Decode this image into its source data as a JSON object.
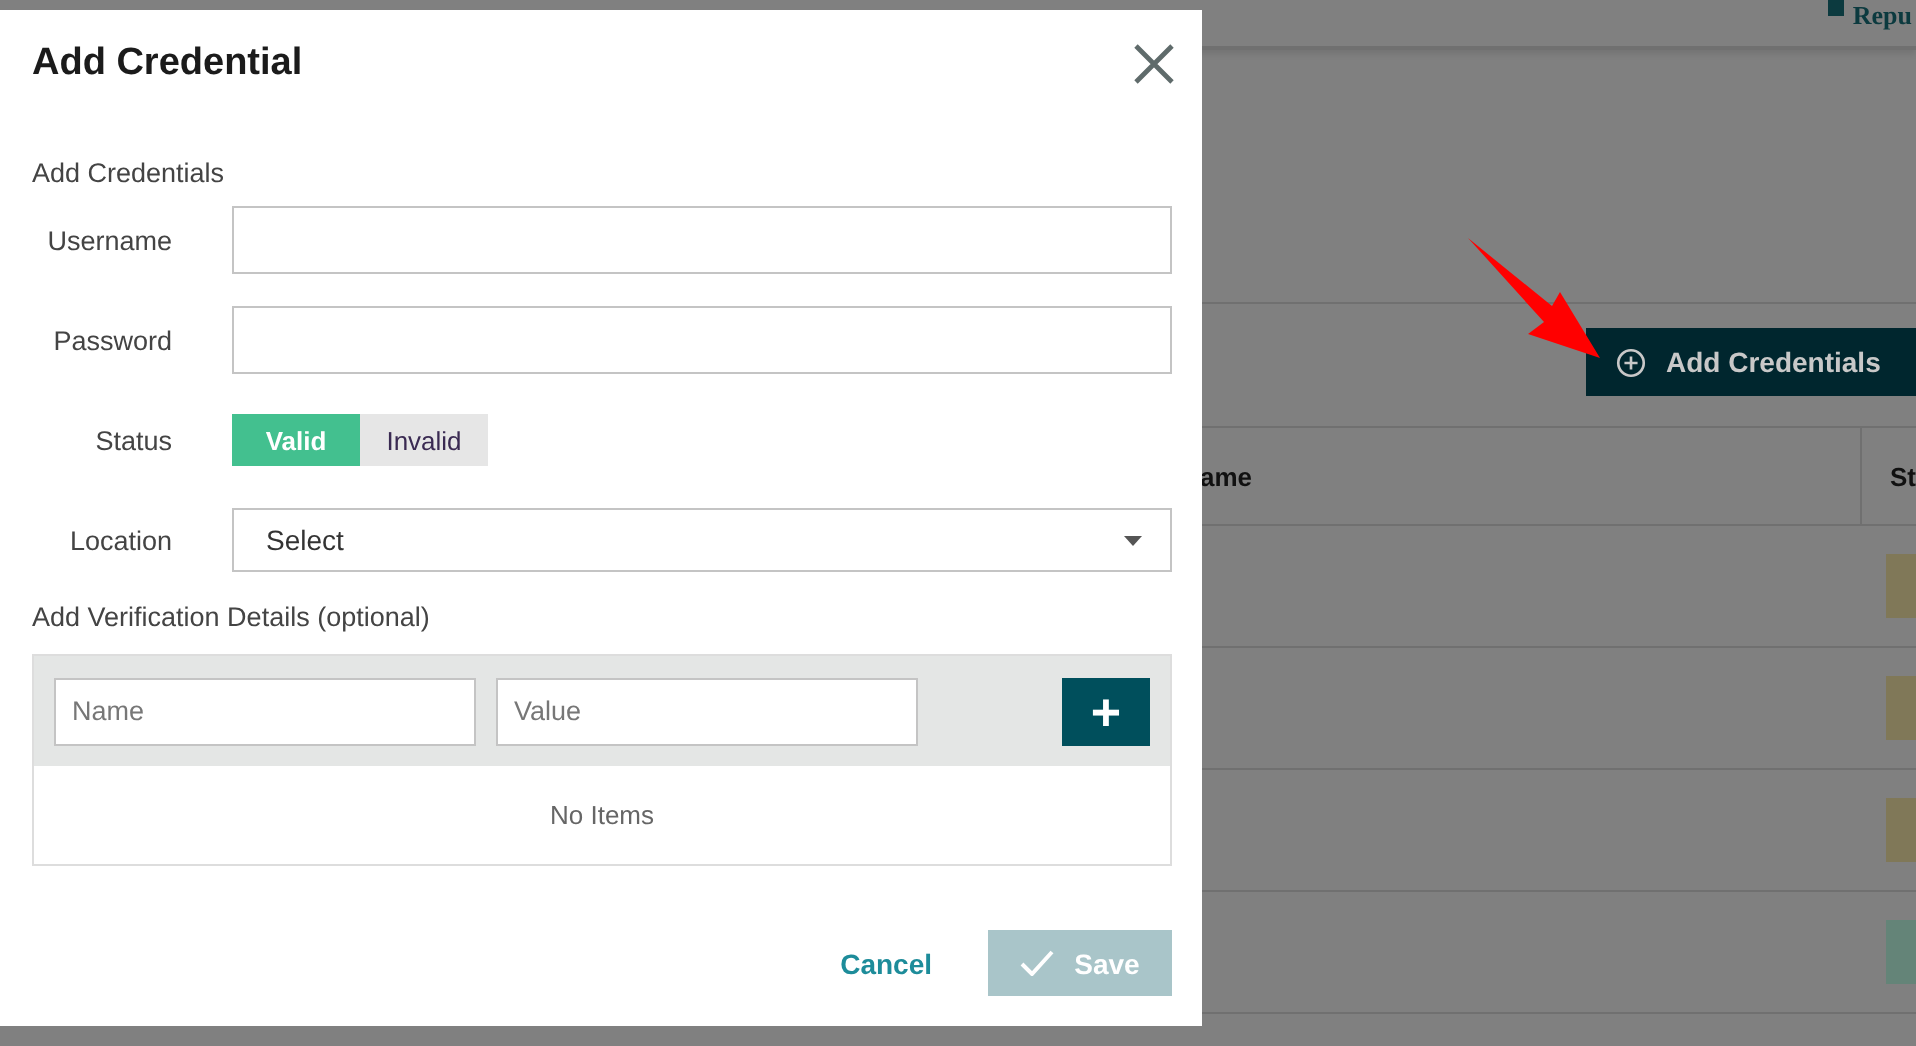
{
  "background_page": {
    "logo": "Repu",
    "add_button": "Add Credentials",
    "table": {
      "columns": [
        "ame",
        "St"
      ],
      "rows": [
        {
          "color": "#807858"
        },
        {
          "color": "#807858"
        },
        {
          "color": "#807858"
        },
        {
          "color": "#648478"
        }
      ]
    }
  },
  "dialog": {
    "title": "Add Credential",
    "section": "Add Credentials",
    "fields": [
      {
        "kind": "text",
        "label": "Username"
      },
      {
        "kind": "text",
        "label": "Password"
      },
      {
        "kind": "toggle",
        "label": "Status",
        "options": [
          {
            "label": "Valid",
            "selected": true
          },
          {
            "label": "Invalid",
            "selected": false
          }
        ]
      },
      {
        "kind": "select",
        "label": "Location",
        "value": "Select"
      }
    ],
    "verification": {
      "title": "Add Verification Details (optional)",
      "name_placeholder": "Name",
      "value_placeholder": "Value",
      "add_button": "+",
      "empty": "No Items"
    },
    "buttons": {
      "cancel": "Cancel",
      "save": {
        "label": "Save",
        "disabled": true
      }
    }
  }
}
